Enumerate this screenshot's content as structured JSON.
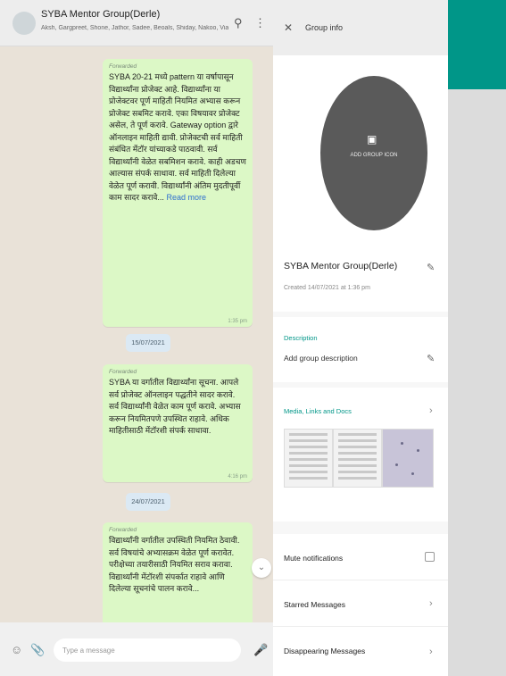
{
  "chat": {
    "title": "SYBA Mentor Group(Derle)",
    "subtitle": "Aksh, Gargpreet, Shone, Jathor, Sadee, Beoals, Shiday, Nakoo, Via...",
    "search_icon": "search-icon",
    "menu_icon": "kebab-menu-icon"
  },
  "messages": [
    {
      "forwarded": "Forwarded",
      "text": "SYBA 20-21 मध्ये pattern या वर्षापासून विद्यार्थ्यांना प्रोजेक्ट आहे. विद्यार्थ्यांना या प्रोजेक्टवर पूर्ण माहिती नियमित अभ्यास करून प्रोजेक्ट सबमिट करावे. एका विषयावर प्रोजेक्ट असेल, ते पूर्ण करावे. Gateway option द्वारे ऑनलाइन माहिती द्यावी. प्रोजेक्टची सर्व माहिती संबंधित मेंटॉर यांच्याकडे पाठवावी. सर्व विद्यार्थ्यांनी वेळेत सबमिशन करावे. काही अडचण आल्यास संपर्क साधावा. सर्व माहिती दिलेल्या वेळेत पूर्ण करावी. विद्यार्थ्यांनी अंतिम मुदतीपूर्वी काम सादर करावे...",
      "read_more": "Read more",
      "time": "1:35 pm"
    },
    {
      "forwarded": "Forwarded",
      "text": "SYBA या वर्गातील विद्यार्थ्यांना सूचना. आपले सर्व प्रोजेक्ट ऑनलाइन पद्धतीने सादर करावे. सर्व विद्यार्थ्यांनी वेळेत काम पूर्ण करावे. अभ्यास करून नियमितपणे उपस्थित राहावे. अधिक माहितीसाठी मेंटॉरशी संपर्क साधावा.",
      "time": "4:16 pm"
    },
    {
      "forwarded": "Forwarded",
      "text": "विद्यार्थ्यांनी वर्गातील उपस्थिती नियमित ठेवावी. सर्व विषयांचे अभ्यासक्रम वेळेत पूर्ण करावेत. परीक्षेच्या तयारीसाठी नियमित सराव करावा. विद्यार्थ्यांनी मेंटॉरशी संपर्कात राहावे आणि दिलेल्या सूचनांचे पालन करावे..."
    }
  ],
  "dates": [
    "15/07/2021",
    "24/07/2021"
  ],
  "composer": {
    "placeholder": "Type a message",
    "emoji_icon": "emoji-icon",
    "attach_icon": "attach-icon",
    "mic_icon": "mic-icon"
  },
  "info": {
    "header_title": "Group info",
    "photo_label": "ADD GROUP ICON",
    "group_name": "SYBA Mentor Group(Derle)",
    "created": "Created 14/07/2021 at 1:36 pm",
    "description_label": "Description",
    "description_placeholder": "Add group description",
    "media_label": "Media, Links and Docs",
    "settings": [
      "Mute notifications",
      "Starred Messages",
      "Disappearing Messages"
    ]
  },
  "colors": {
    "accent": "#009688",
    "bubble": "#dcf8c6",
    "chat_bg": "#e9e2d8"
  }
}
